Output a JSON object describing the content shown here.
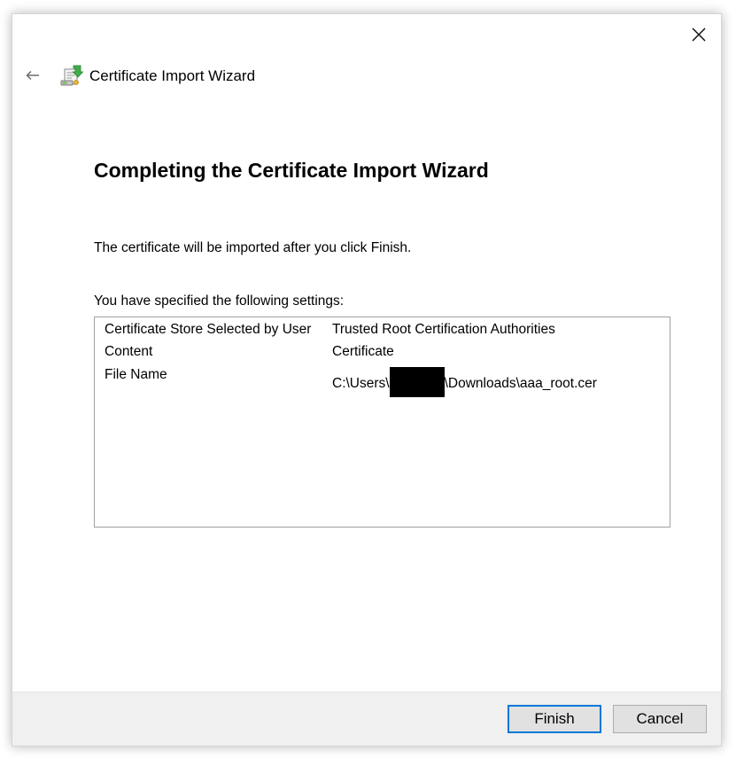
{
  "window": {
    "title": "Certificate Import Wizard"
  },
  "page": {
    "heading": "Completing the Certificate Import Wizard",
    "description": "The certificate will be imported after you click Finish.",
    "settings_label": "You have specified the following settings:"
  },
  "settings": [
    {
      "key": "Certificate Store Selected by User",
      "value": "Trusted Root Certification Authorities"
    },
    {
      "key": "Content",
      "value": "Certificate"
    },
    {
      "key": "File Name",
      "value_prefix": "C:\\Users\\",
      "value_suffix": "\\Downloads\\aaa_root.cer"
    }
  ],
  "buttons": {
    "finish": "Finish",
    "cancel": "Cancel"
  },
  "icons": {
    "close": "close-icon",
    "back": "back-arrow-icon",
    "wizard": "certificate-wizard-icon"
  },
  "colors": {
    "accent": "#0078d7",
    "footer_bg": "#f0f0f0"
  }
}
